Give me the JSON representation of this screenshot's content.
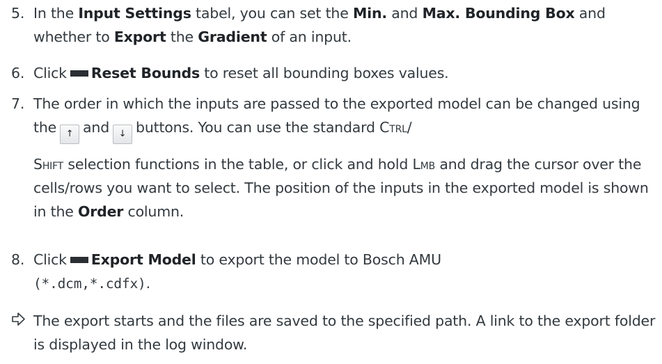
{
  "steps": [
    {
      "number": "5.",
      "t1": "In the ",
      "b1": "Input Settings",
      "t2": " tabel, you can set the ",
      "b2": "Min.",
      "t3": " and ",
      "b3": "Max. Bounding Box",
      "t4": " and whether to ",
      "b4": "Export",
      "t5": " the ",
      "b5": "Gradient",
      "t6": " of an input."
    },
    {
      "number": "6.",
      "t1": "Click",
      "icon": "button-icon",
      "b1": "Reset Bounds",
      "t2": " to reset all bounding boxes values."
    },
    {
      "number": "7.",
      "t1": "The order in which the inputs are passed to the exported model can be changed using the",
      "up_glyph": "↑",
      "t2": "and",
      "down_glyph": "↓",
      "t3": "buttons. You can use the standard ",
      "key_ctrl": "Ctrl",
      "t4": "/",
      "key_shift": "Shift",
      "t5": " selection functions in the table, or click and hold ",
      "key_lmb": "Lmb",
      "t6": " and drag the cursor over the cells/rows you want to select. The position of the inputs in the exported model is shown in the ",
      "b1": "Order",
      "t7": " column."
    },
    {
      "number": "8.",
      "t1": "Click",
      "icon": "button-icon",
      "b1": "Export Model",
      "t2": " to export the model to Bosch AMU",
      "code": "(*.dcm,*.cdfx)",
      "t3": "."
    }
  ],
  "result": {
    "icon": "result-arrow-icon",
    "text": "The export starts and the files are saved to the specified path. A link to the export folder is displayed in the log window."
  }
}
